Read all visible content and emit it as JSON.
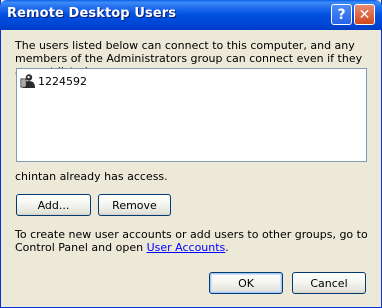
{
  "window": {
    "title": "Remote Desktop Users",
    "help_glyph": "?",
    "close_glyph": "✕"
  },
  "intro_text": "The users listed below can connect to this computer, and any members of the Administrators group can connect even if they are not listed.",
  "users": [
    {
      "name": "1224592",
      "icon": "user-icon"
    }
  ],
  "access_status": "chintan already has access.",
  "buttons": {
    "add": "Add...",
    "remove": "Remove",
    "ok": "OK",
    "cancel": "Cancel"
  },
  "footer": {
    "text_before_link": "To create new user accounts or add users to other groups, go to Control Panel and open ",
    "link_text": "User Accounts",
    "text_after_link": "."
  },
  "colors": {
    "titlebar": "#0054e3",
    "dialog_bg": "#ece9d8",
    "link": "#0000ff"
  }
}
